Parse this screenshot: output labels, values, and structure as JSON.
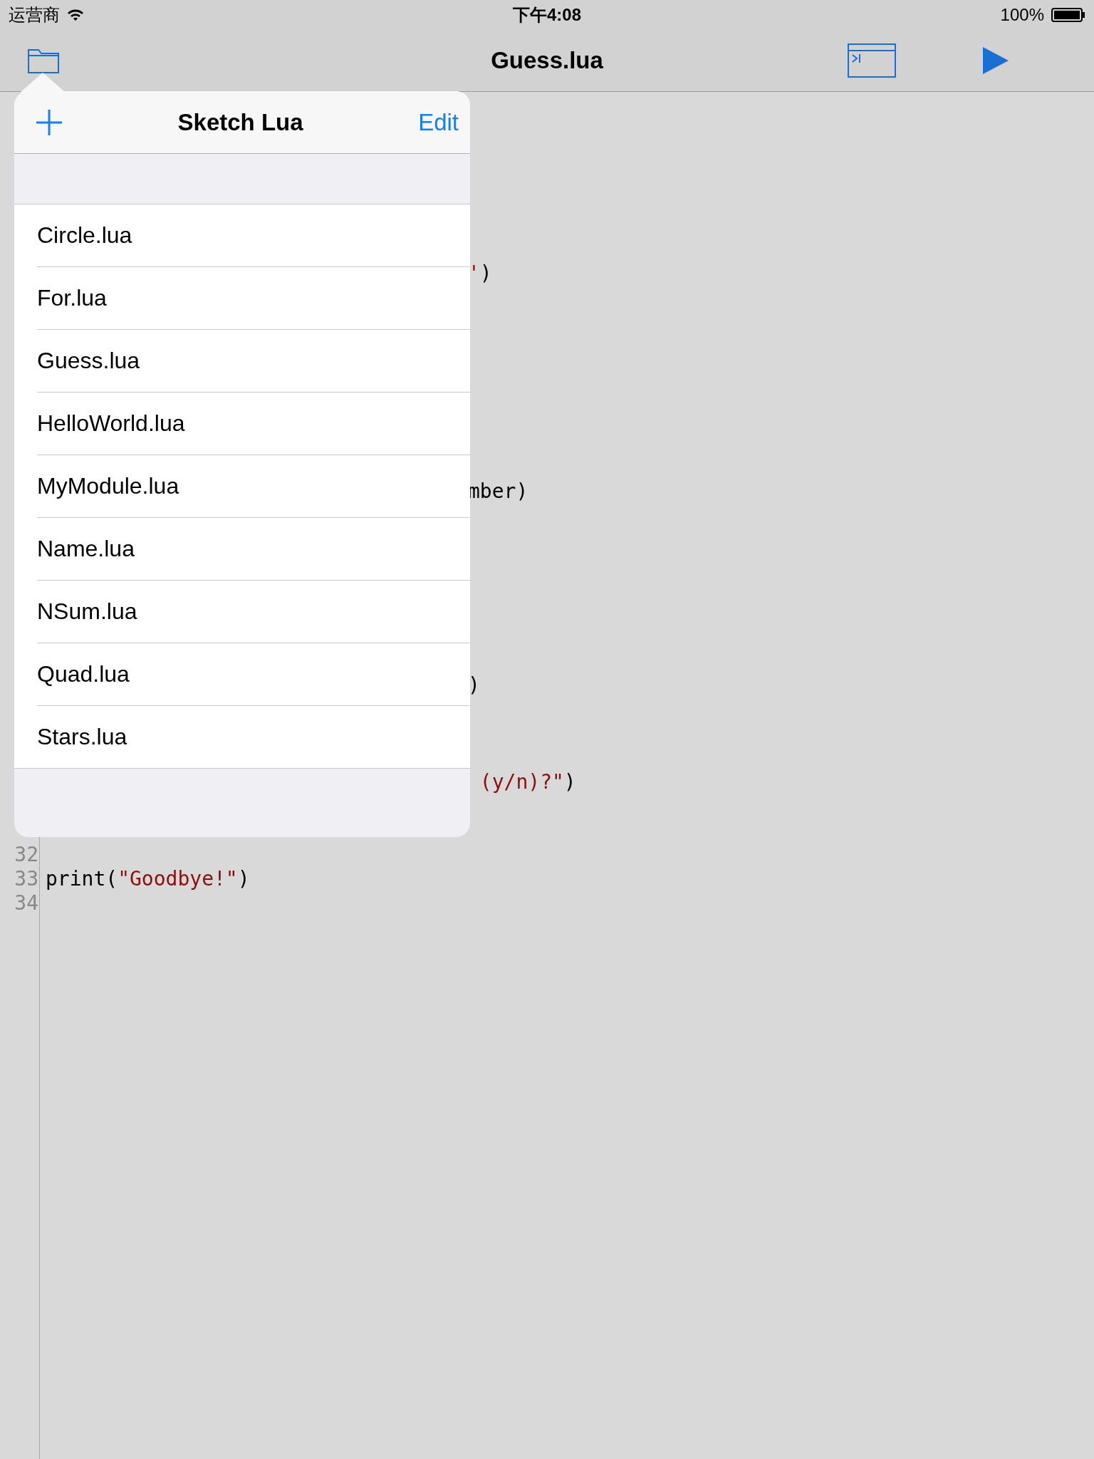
{
  "status_bar": {
    "carrier": "运营商",
    "time": "下午4:08",
    "battery": "100%"
  },
  "nav_bar": {
    "title": "Guess.lua"
  },
  "editor": {
    "lines": [
      {
        "segments": [
          {
            "kind": "string",
            "text": "'"
          },
          {
            "kind": "plain",
            "text": ")"
          }
        ]
      },
      {
        "segments": [
          {
            "kind": "plain",
            "text": "mber)"
          }
        ]
      },
      {
        "segments": [
          {
            "kind": "plain",
            "text": ")"
          }
        ]
      },
      {
        "segments": [
          {
            "kind": "string",
            "text": " (y/n)?\""
          },
          {
            "kind": "plain",
            "text": ")"
          }
        ]
      },
      {
        "number": "32"
      },
      {
        "number": "33",
        "segments": [
          {
            "kind": "plain",
            "text": "print("
          },
          {
            "kind": "string",
            "text": "\"Goodbye!\""
          },
          {
            "kind": "plain",
            "text": ")"
          }
        ]
      },
      {
        "number": "34"
      }
    ]
  },
  "popover": {
    "title": "Sketch Lua",
    "edit": "Edit",
    "files": [
      "Circle.lua",
      "For.lua",
      "Guess.lua",
      "HelloWorld.lua",
      "MyModule.lua",
      "Name.lua",
      "NSum.lua",
      "Quad.lua",
      "Stars.lua"
    ]
  }
}
